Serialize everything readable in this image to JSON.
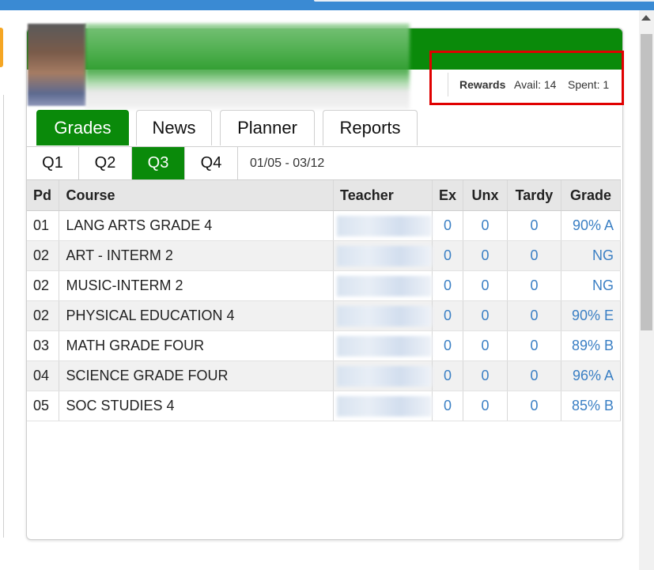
{
  "window": {
    "accent_color": "#3a8ad3",
    "brand_green": "#0a8a0a"
  },
  "rewards": {
    "label": "Rewards",
    "avail": "Avail: 14",
    "spent": "Spent: 1"
  },
  "tabs": [
    {
      "label": "Grades",
      "active": true
    },
    {
      "label": "News",
      "active": false
    },
    {
      "label": "Planner",
      "active": false
    },
    {
      "label": "Reports",
      "active": false
    }
  ],
  "quarters": [
    {
      "label": "Q1",
      "active": false
    },
    {
      "label": "Q2",
      "active": false
    },
    {
      "label": "Q3",
      "active": true
    },
    {
      "label": "Q4",
      "active": false
    }
  ],
  "date_range": "01/05 - 03/12",
  "table": {
    "headers": {
      "pd": "Pd",
      "course": "Course",
      "teacher": "Teacher",
      "ex": "Ex",
      "unx": "Unx",
      "tardy": "Tardy",
      "grade": "Grade"
    },
    "rows": [
      {
        "pd": "01",
        "course": "LANG ARTS GRADE 4",
        "ex": "0",
        "unx": "0",
        "tardy": "0",
        "grade": "90% A"
      },
      {
        "pd": "02",
        "course": "ART - INTERM 2",
        "ex": "0",
        "unx": "0",
        "tardy": "0",
        "grade": "NG"
      },
      {
        "pd": "02",
        "course": "MUSIC-INTERM 2",
        "ex": "0",
        "unx": "0",
        "tardy": "0",
        "grade": "NG"
      },
      {
        "pd": "02",
        "course": "PHYSICAL EDUCATION 4",
        "ex": "0",
        "unx": "0",
        "tardy": "0",
        "grade": "90% E"
      },
      {
        "pd": "03",
        "course": "MATH GRADE FOUR",
        "ex": "0",
        "unx": "0",
        "tardy": "0",
        "grade": "89% B"
      },
      {
        "pd": "04",
        "course": "SCIENCE GRADE FOUR",
        "ex": "0",
        "unx": "0",
        "tardy": "0",
        "grade": "96% A"
      },
      {
        "pd": "05",
        "course": "SOC STUDIES 4",
        "ex": "0",
        "unx": "0",
        "tardy": "0",
        "grade": "85% B"
      }
    ]
  }
}
